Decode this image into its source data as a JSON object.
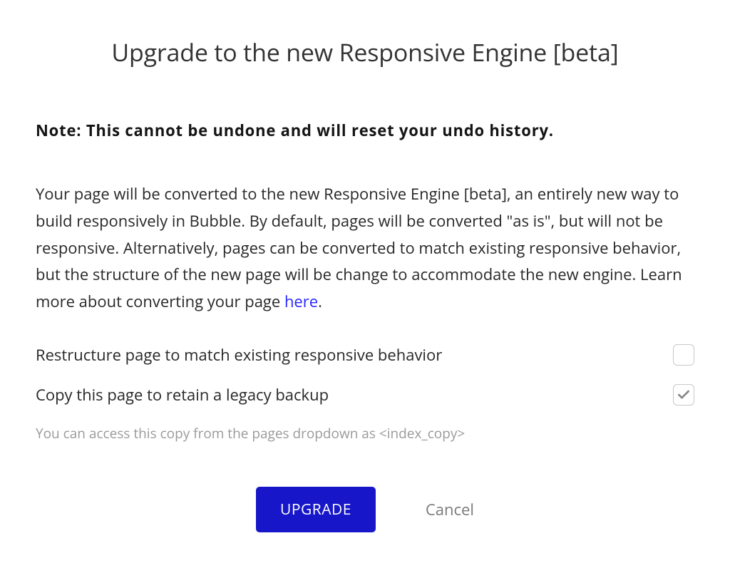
{
  "title": "Upgrade to the new Responsive Engine [beta]",
  "note": "Note: This cannot be undone and will reset your undo history.",
  "description_pre": "Your page will be converted to the new Responsive Engine [beta], an entirely new way to build responsively in Bubble. By default, pages will be converted \"as is\", but will not be responsive. Alternatively, pages can be converted to match existing responsive behavior, but the structure of the new page will be change to accommodate the new engine. Learn more about converting your page ",
  "description_link": "here",
  "description_post": ".",
  "options": {
    "restructure": {
      "label": "Restructure page to match existing responsive behavior",
      "checked": false
    },
    "backup": {
      "label": "Copy this page to retain a legacy backup",
      "hint": "You can access this copy from the pages dropdown as <index_copy>",
      "checked": true
    }
  },
  "actions": {
    "upgrade": "UPGRADE",
    "cancel": "Cancel"
  }
}
